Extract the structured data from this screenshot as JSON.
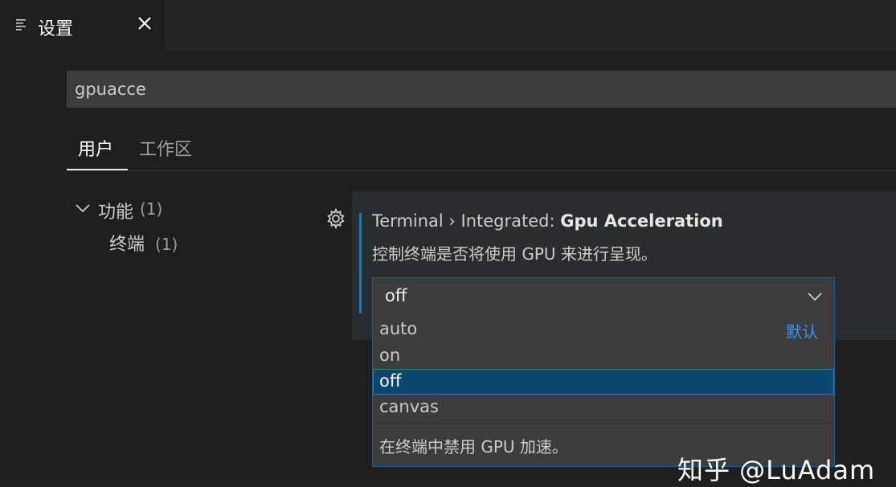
{
  "tab": {
    "title": "设置"
  },
  "search": {
    "value": "gpuacce"
  },
  "scope_tabs": [
    {
      "label": "用户",
      "active": true
    },
    {
      "label": "工作区",
      "active": false
    }
  ],
  "toc": {
    "group": {
      "label": "功能",
      "count": "(1)"
    },
    "child": {
      "label": "终端",
      "count": "(1)"
    }
  },
  "setting": {
    "breadcrumb": "Terminal › Integrated: ",
    "name": "Gpu Acceleration",
    "description": "控制终端是否将使用 GPU 来进行呈现。",
    "selected_value": "off",
    "options": [
      {
        "label": "auto",
        "badge": "默认"
      },
      {
        "label": "on",
        "badge": ""
      },
      {
        "label": "off",
        "badge": ""
      },
      {
        "label": "canvas",
        "badge": ""
      }
    ],
    "option_description": "在终端中禁用 GPU 加速。"
  },
  "watermark": "知乎 @LuAdam",
  "colors": {
    "accent": "#0e7ad1",
    "selected_option_bg": "#094771",
    "default_badge": "#3794ff",
    "editor_bg": "#1e1e1e"
  },
  "icons": {
    "tab": "settings-list-icon",
    "close": "close-icon",
    "gear": "gear-icon",
    "select": "chevron-down-icon",
    "toc": "chevron-down-icon"
  }
}
